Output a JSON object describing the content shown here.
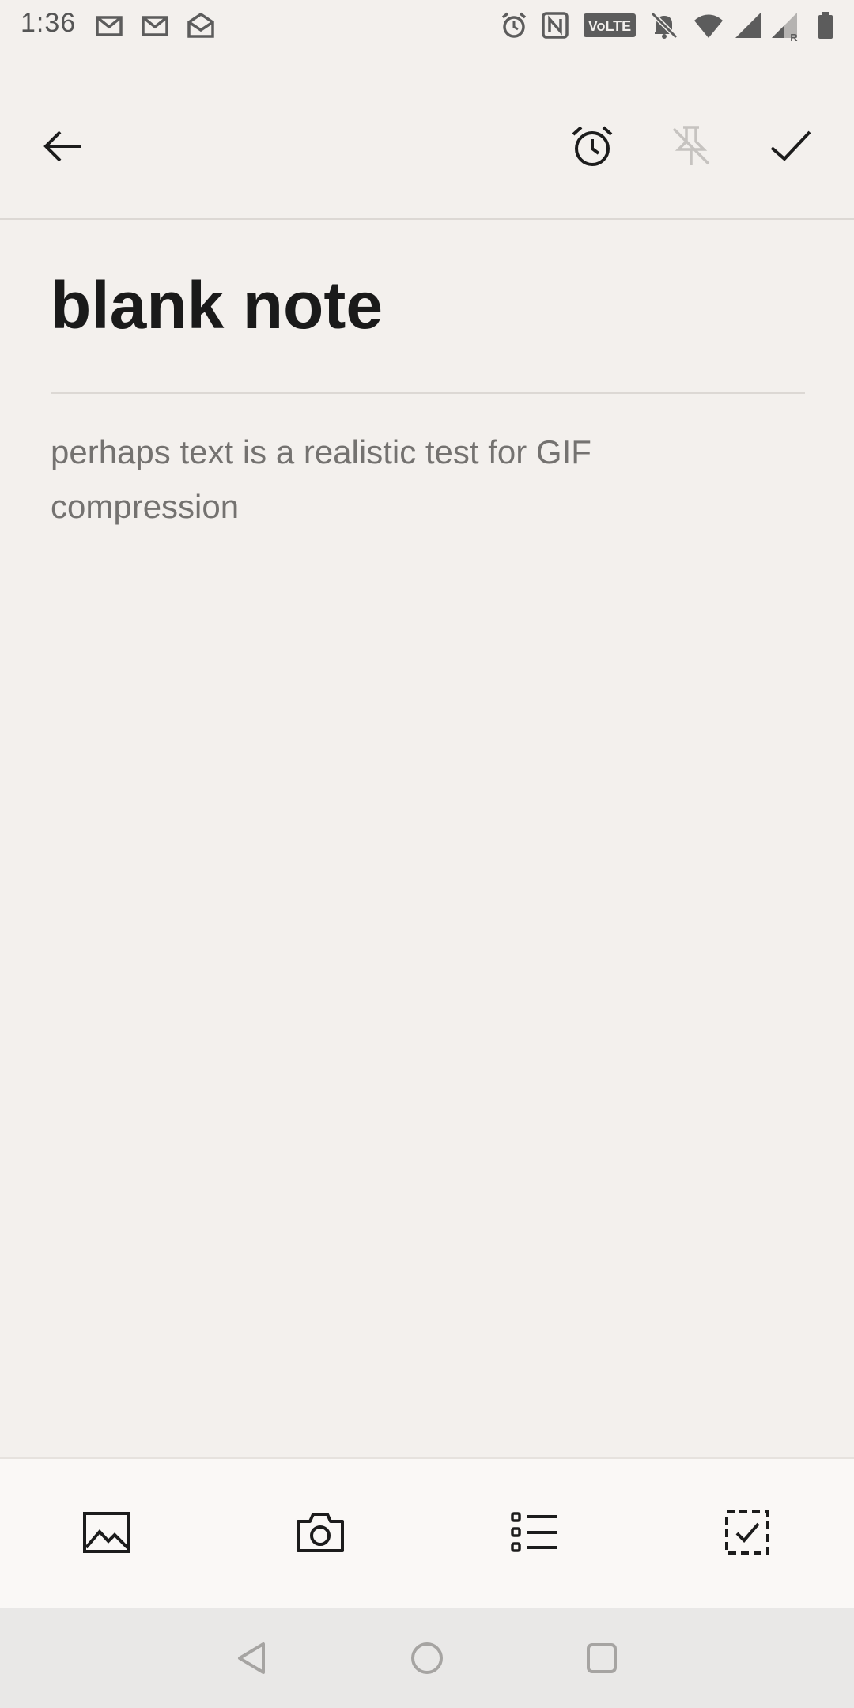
{
  "status_bar": {
    "time": "1:36",
    "left_icons": [
      "gmail-icon",
      "gmail-icon",
      "mail-open-icon"
    ],
    "right_icons": [
      "alarm-icon",
      "nfc-icon",
      "volte-icon",
      "notifications-off-icon",
      "wifi-icon",
      "signal-icon",
      "signal-roaming-icon",
      "battery-icon"
    ],
    "volte_label": "VoLTE",
    "roaming_label": "R"
  },
  "top_bar": {
    "back_icon": "arrow-back-icon",
    "reminder_icon": "alarm-clock-icon",
    "pin_icon": "pin-off-icon",
    "done_icon": "checkmark-icon"
  },
  "note": {
    "title": "blank note",
    "body": "perhaps text is a realistic test for GIF compression"
  },
  "bottom_toolbar": {
    "items": [
      "image-icon",
      "camera-icon",
      "bulleted-list-icon",
      "checkbox-icon"
    ]
  },
  "nav_bar": {
    "items": [
      "nav-back-icon",
      "nav-home-icon",
      "nav-recents-icon"
    ]
  },
  "colors": {
    "background": "#f3f0ed",
    "toolbar_bg": "#faf8f6",
    "nav_bg": "#e9e8e7",
    "title_text": "#1a1a1a",
    "body_text": "#747270",
    "disabled_icon": "#c6c3c0"
  }
}
